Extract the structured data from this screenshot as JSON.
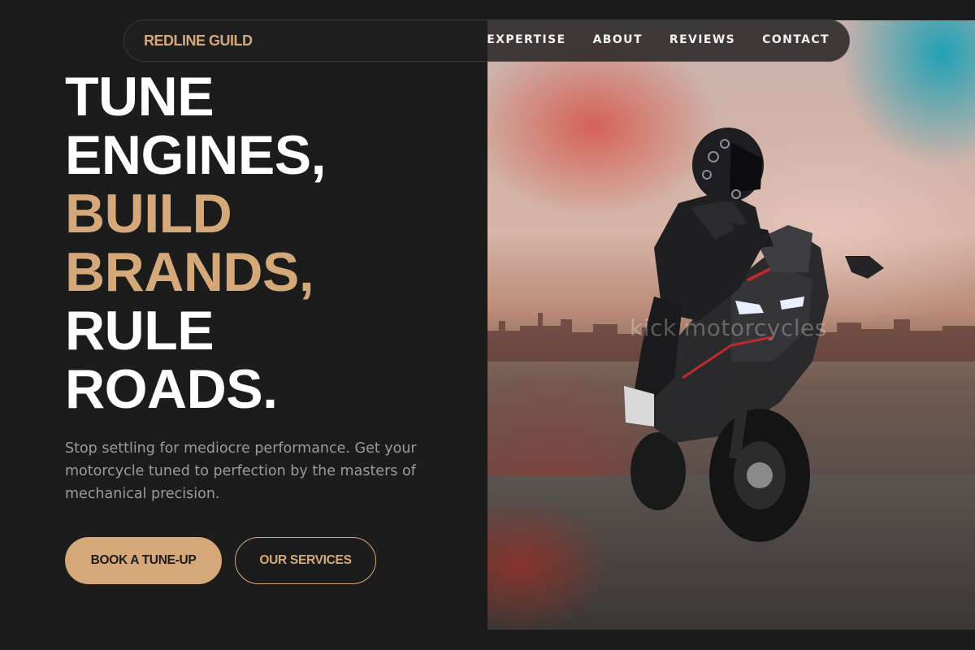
{
  "brand": {
    "name": "REDLINE GUILD"
  },
  "nav": {
    "items": [
      {
        "label": "EXPERTISE"
      },
      {
        "label": "ABOUT"
      },
      {
        "label": "REVIEWS"
      },
      {
        "label": "CONTACT"
      }
    ]
  },
  "hero": {
    "headline": {
      "line1": "TUNE",
      "line2": "ENGINES,",
      "line3": "BUILD",
      "line4": "BRANDS,",
      "line5": "RULE",
      "line6": "ROADS."
    },
    "subtext": "Stop settling for mediocre performance. Get your motorcycle tuned to perfection by the masters of mechanical precision.",
    "primary_button": "BOOK A TUNE-UP",
    "secondary_button": "OUR SERVICES",
    "image_watermark": "kick motorcycles"
  },
  "colors": {
    "background": "#1c1c1c",
    "accent": "#d4a878",
    "headline": "#ffffff",
    "body_text": "#9b9b9b"
  }
}
